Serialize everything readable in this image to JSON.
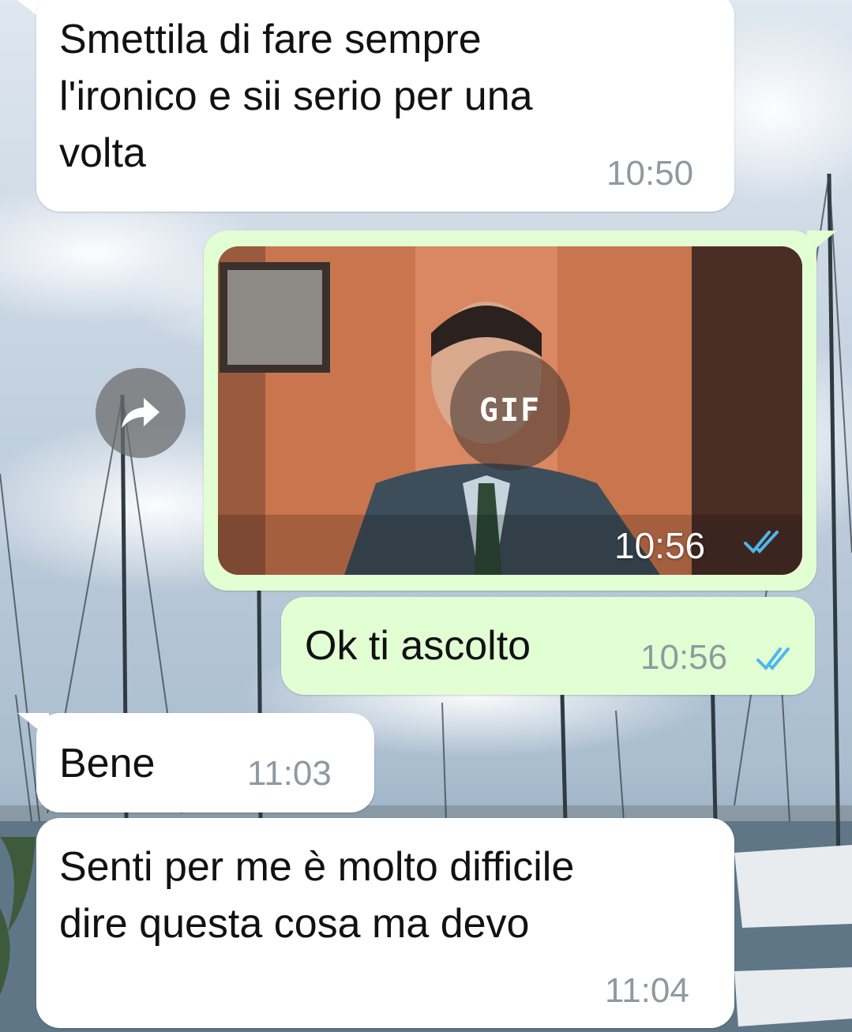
{
  "messages": [
    {
      "direction": "in",
      "text_lines": [
        "Smettila di fare sempre",
        "l'ironico e sii serio per una",
        "volta"
      ],
      "time": "10:50"
    },
    {
      "direction": "out",
      "type": "gif",
      "badge": "GIF",
      "time": "10:56",
      "status_icon": "double-check-icon"
    },
    {
      "direction": "out",
      "text_lines": [
        "Ok ti ascolto"
      ],
      "time": "10:56",
      "status_icon": "double-check-icon"
    },
    {
      "direction": "in",
      "text_lines": [
        "Bene"
      ],
      "time": "11:03"
    },
    {
      "direction": "in",
      "text_lines": [
        "Senti per me è molto difficile",
        "dire questa cosa ma devo"
      ],
      "time": "11:04"
    }
  ],
  "forward_button": {
    "icon": "share-arrow-icon"
  },
  "colors": {
    "incoming_bubble": "#ffffff",
    "outgoing_bubble": "#e2ffd4",
    "read_ticks": "#4fb6ec",
    "timestamp": "#8f9a9f"
  }
}
